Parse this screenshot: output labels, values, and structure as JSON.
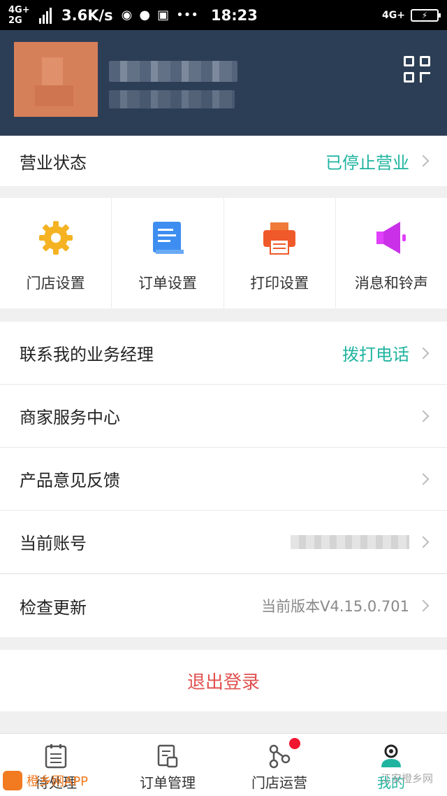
{
  "status_bar": {
    "net_top": "4G+",
    "net_bottom": "2G",
    "speed": "3.6K/s",
    "time": "18:23",
    "net_right": "4G+",
    "battery": "⚡"
  },
  "business_status": {
    "label": "营业状态",
    "value": "已停止营业"
  },
  "quick_actions": [
    {
      "label": "门店设置",
      "icon": "gear-icon"
    },
    {
      "label": "订单设置",
      "icon": "document-icon"
    },
    {
      "label": "打印设置",
      "icon": "printer-icon"
    },
    {
      "label": "消息和铃声",
      "icon": "speaker-icon"
    }
  ],
  "menu": {
    "manager": {
      "label": "联系我的业务经理",
      "value": "拨打电话"
    },
    "service_center": {
      "label": "商家服务中心"
    },
    "feedback": {
      "label": "产品意见反馈"
    },
    "account": {
      "label": "当前账号"
    },
    "update": {
      "label": "检查更新",
      "value": "当前版本V4.15.0.701"
    }
  },
  "logout_label": "退出登录",
  "tabs": [
    {
      "label": "待处理",
      "icon": "clipboard-icon",
      "active": false
    },
    {
      "label": "订单管理",
      "icon": "order-list-icon",
      "active": false
    },
    {
      "label": "门店运营",
      "icon": "branch-icon",
      "active": false,
      "badge": true
    },
    {
      "label": "我的",
      "icon": "user-icon",
      "active": true
    }
  ],
  "watermarks": {
    "left": "橙乡网APP",
    "right": "江安橙乡网"
  },
  "colors": {
    "accent": "#20b4a0",
    "header": "#2c3e55",
    "danger": "#e0504f"
  }
}
